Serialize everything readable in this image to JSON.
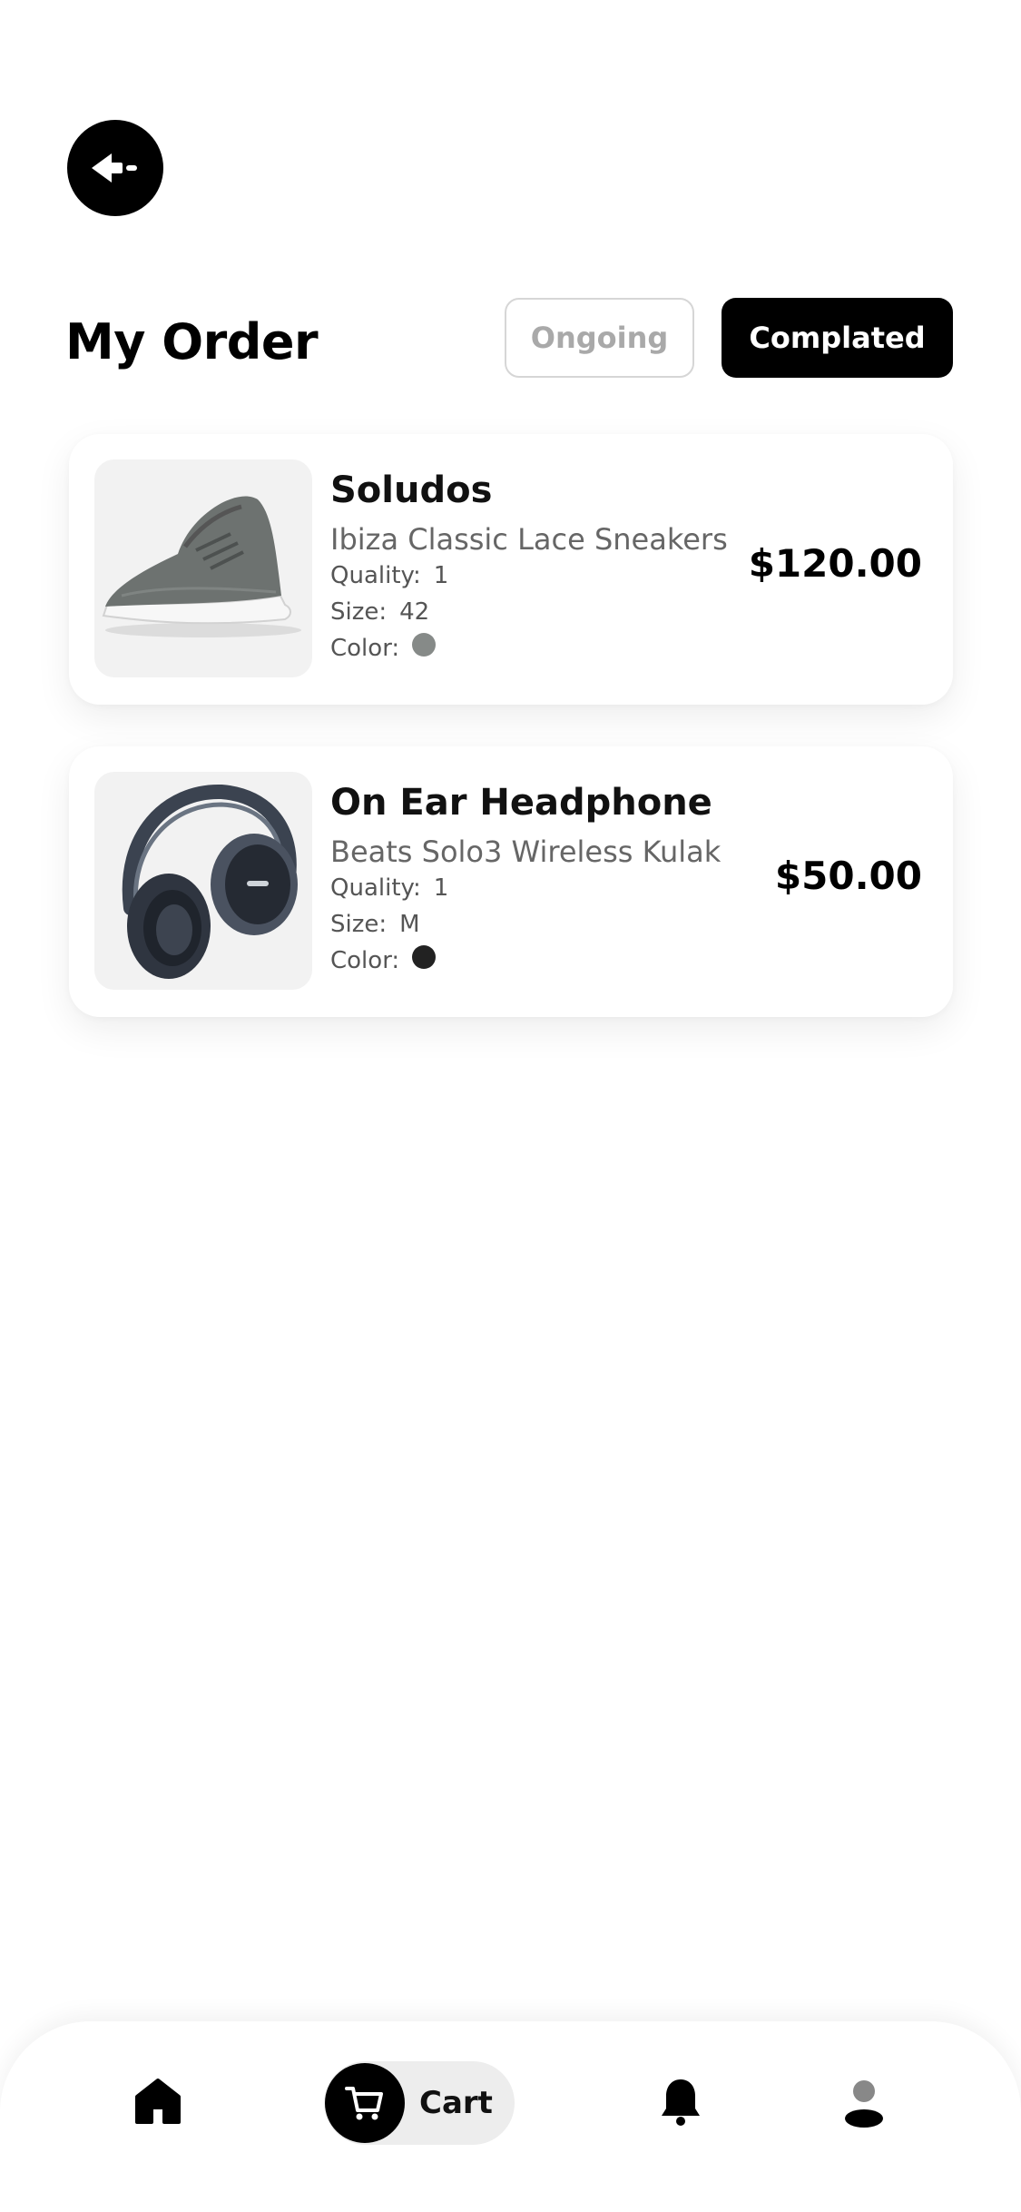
{
  "header": {
    "back_icon": "back-arrow-icon",
    "title": "My Order"
  },
  "tabs": [
    {
      "label": "Ongoing",
      "active": false
    },
    {
      "label": "Complated",
      "active": true
    }
  ],
  "orders": [
    {
      "name": "Soludos",
      "subtitle": "Ibiza Classic Lace Sneakers",
      "quality_label": "Quality:",
      "quality": "1",
      "size_label": "Size:",
      "size": "42",
      "color_label": "Color:",
      "color": "#868a88",
      "price": "$120.00",
      "image_icon": "sneaker-image"
    },
    {
      "name": "On Ear Headphone",
      "subtitle": "Beats Solo3 Wireless Kulak",
      "quality_label": "Quality:",
      "quality": "1",
      "size_label": "Size:",
      "size": "M",
      "color_label": "Color:",
      "color": "#222222",
      "price": "$50.00",
      "image_icon": "headphone-image"
    }
  ],
  "bottom_nav": {
    "items": [
      {
        "icon": "home-icon",
        "label": ""
      },
      {
        "icon": "cart-icon",
        "label": "Cart",
        "active": true
      },
      {
        "icon": "bell-icon",
        "label": ""
      },
      {
        "icon": "profile-icon",
        "label": ""
      }
    ]
  },
  "colors": {
    "accent": "#000000",
    "background": "#ffffff",
    "card": "#ffffff",
    "thumb_bg": "#f2f2f2"
  }
}
